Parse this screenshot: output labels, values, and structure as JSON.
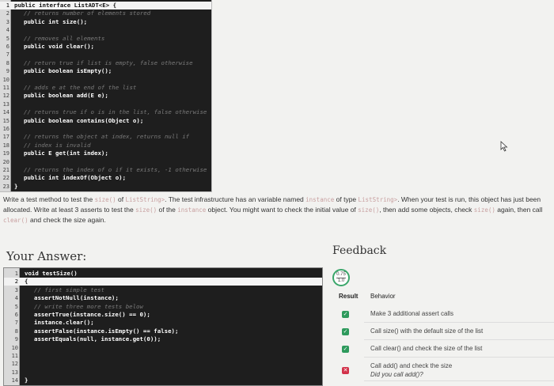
{
  "top_editor": {
    "lines": [
      {
        "n": "1",
        "text": "public interface ListADT<E> {",
        "indent": 0,
        "kind": "code",
        "active": true
      },
      {
        "n": "2",
        "text": "// returns number of elements stored",
        "indent": 1,
        "kind": "comment"
      },
      {
        "n": "3",
        "text": "public int size();",
        "indent": 1,
        "kind": "code"
      },
      {
        "n": "4",
        "text": "",
        "indent": 0,
        "kind": "code"
      },
      {
        "n": "5",
        "text": "// removes all elements",
        "indent": 1,
        "kind": "comment"
      },
      {
        "n": "6",
        "text": "public void clear();",
        "indent": 1,
        "kind": "code"
      },
      {
        "n": "7",
        "text": "",
        "indent": 0,
        "kind": "code"
      },
      {
        "n": "8",
        "text": "// return true if list is empty, false otherwise",
        "indent": 1,
        "kind": "comment"
      },
      {
        "n": "9",
        "text": "public boolean isEmpty();",
        "indent": 1,
        "kind": "code"
      },
      {
        "n": "10",
        "text": "",
        "indent": 0,
        "kind": "code"
      },
      {
        "n": "11",
        "text": "// adds e at the end of the list",
        "indent": 1,
        "kind": "comment"
      },
      {
        "n": "12",
        "text": "public boolean add(E e);",
        "indent": 1,
        "kind": "code"
      },
      {
        "n": "13",
        "text": "",
        "indent": 0,
        "kind": "code"
      },
      {
        "n": "14",
        "text": "// returns true if o is in the list, false otherwise",
        "indent": 1,
        "kind": "comment"
      },
      {
        "n": "15",
        "text": "public boolean contains(Object o);",
        "indent": 1,
        "kind": "code"
      },
      {
        "n": "16",
        "text": "",
        "indent": 0,
        "kind": "code"
      },
      {
        "n": "17",
        "text": "// returns the object at index, returns null if",
        "indent": 1,
        "kind": "comment"
      },
      {
        "n": "18",
        "text": "// index is invalid",
        "indent": 1,
        "kind": "comment"
      },
      {
        "n": "19",
        "text": "public E get(int index);",
        "indent": 1,
        "kind": "code"
      },
      {
        "n": "20",
        "text": "",
        "indent": 0,
        "kind": "code"
      },
      {
        "n": "21",
        "text": "// returns the index of o if it exists, -1 otherwise",
        "indent": 1,
        "kind": "comment"
      },
      {
        "n": "22",
        "text": "public int indexOf(Object o);",
        "indent": 1,
        "kind": "code"
      },
      {
        "n": "23",
        "text": "}",
        "indent": 0,
        "kind": "code"
      }
    ]
  },
  "description": {
    "p1": "Write a test method to test the ",
    "c1": "size()",
    "p2": " of ",
    "c2": "ListString>",
    "p3": ". The test infrastructure has an variable named ",
    "c3": "instance",
    "p4": " of type ",
    "c4": "ListString>",
    "p5": ". When your test is run, this object has just been allocated. Write at least 3 asserts to test the ",
    "c5": "size()",
    "p6": " of the ",
    "c6": "instance",
    "p7": " object. You might want to check the initial value of ",
    "c7": "size()",
    "p8": ", then add some objects, check ",
    "c8": "size()",
    "p9": " again, then call ",
    "c9": "clear()",
    "p10": " and check the size again."
  },
  "labels": {
    "your_answer": "Your Answer:",
    "feedback": "Feedback"
  },
  "answer_editor": {
    "lines": [
      {
        "n": "1",
        "text": "void testSize()",
        "indent": 0,
        "kind": "code"
      },
      {
        "n": "2",
        "text": "{",
        "indent": 0,
        "kind": "code",
        "active": true
      },
      {
        "n": "3",
        "text": "// first simple test",
        "indent": 1,
        "kind": "comment"
      },
      {
        "n": "4",
        "text": "assertNotNull(instance);",
        "indent": 1,
        "kind": "code"
      },
      {
        "n": "5",
        "text": "// write three more tests below",
        "indent": 1,
        "kind": "comment"
      },
      {
        "n": "6",
        "text": "assertTrue(instance.size() == 0);",
        "indent": 1,
        "kind": "code"
      },
      {
        "n": "7",
        "text": "instance.clear();",
        "indent": 1,
        "kind": "code"
      },
      {
        "n": "8",
        "text": "assertFalse(instance.isEmpty() == false);",
        "indent": 1,
        "kind": "code"
      },
      {
        "n": "9",
        "text": "assertEquals(null, instance.get(0));",
        "indent": 1,
        "kind": "code"
      },
      {
        "n": "10",
        "text": "",
        "indent": 0,
        "kind": "code"
      },
      {
        "n": "11",
        "text": "",
        "indent": 0,
        "kind": "code"
      },
      {
        "n": "12",
        "text": "",
        "indent": 0,
        "kind": "code"
      },
      {
        "n": "13",
        "text": "",
        "indent": 0,
        "kind": "code"
      },
      {
        "n": "14",
        "text": "}",
        "indent": 0,
        "kind": "code"
      }
    ]
  },
  "grade": {
    "score": "0.75",
    "total": "1.0"
  },
  "feedback_table": {
    "headers": [
      "Result",
      "Behavior"
    ],
    "rows": [
      {
        "status": "pass",
        "behavior": "Make 3 additional assert calls",
        "sub": ""
      },
      {
        "status": "pass",
        "behavior": "Call size() with the default size of the list",
        "sub": ""
      },
      {
        "status": "pass",
        "behavior": "Call clear() and check the size of the list",
        "sub": ""
      },
      {
        "status": "fail",
        "behavior": "Call add() and check the size",
        "sub": "Did you call add()?"
      }
    ]
  },
  "colors": {
    "editor_bg": "#1e1e1e",
    "pass": "#2e9a5c",
    "fail": "#d2324a",
    "grade_ring": "#3aa66a"
  },
  "icons": {
    "pass": "check-icon",
    "fail": "cross-icon",
    "pointer": "mouse-cursor-icon"
  }
}
